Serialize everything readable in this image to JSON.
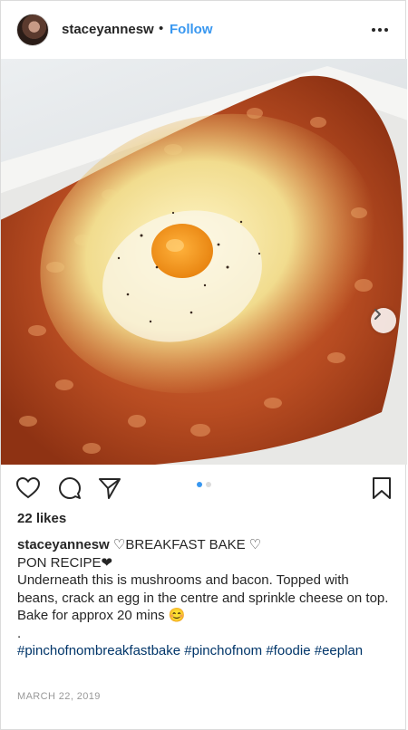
{
  "header": {
    "username": "staceyannesw",
    "separator": "•",
    "follow_label": "Follow"
  },
  "carousel": {
    "count": 2,
    "active_index": 0
  },
  "likes": "22 likes",
  "caption": {
    "username": "staceyannesw",
    "title": "♡BREAKFAST BAKE ♡",
    "line2": "PON RECIPE❤",
    "body": "Underneath this is mushrooms and bacon. Topped with beans, crack an egg in the centre and sprinkle cheese on top.",
    "bake": "Bake for approx 20 mins",
    "emoji": "😊",
    "dot": ".",
    "hashtags": "#pinchofnombreakfastbake #pinchofnom #foodie #eeplan"
  },
  "date": "MARCH 22, 2019",
  "colors": {
    "link_blue": "#3897f0",
    "hashtag": "#003569",
    "dot_active": "#3897f0",
    "dot_inactive": "#dbdbdb",
    "muted": "#999999"
  },
  "icons": {
    "like": "heart-icon",
    "comment": "comment-icon",
    "share": "share-icon",
    "save": "bookmark-icon",
    "next": "chevron-right-icon",
    "more": "more-icon"
  }
}
